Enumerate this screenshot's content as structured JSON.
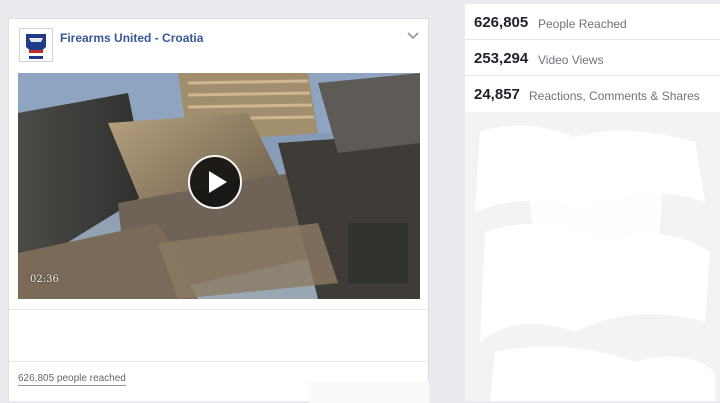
{
  "post": {
    "page_name": "Firearms United - Croatia",
    "video": {
      "duration": "02:36"
    },
    "footer_reach": "626,805 people reached"
  },
  "stats": [
    {
      "value": "626,805",
      "label": "People Reached"
    },
    {
      "value": "253,294",
      "label": "Video Views"
    },
    {
      "value": "24,857",
      "label": "Reactions, Comments & Shares"
    }
  ],
  "icons": {
    "chevron": "chevron-down-icon",
    "play": "play-icon",
    "avatar": "page-logo"
  },
  "colors": {
    "page_name": "#365899",
    "background": "#e9ebee",
    "stat_number": "#1d2129",
    "stat_label": "#6f737a"
  }
}
